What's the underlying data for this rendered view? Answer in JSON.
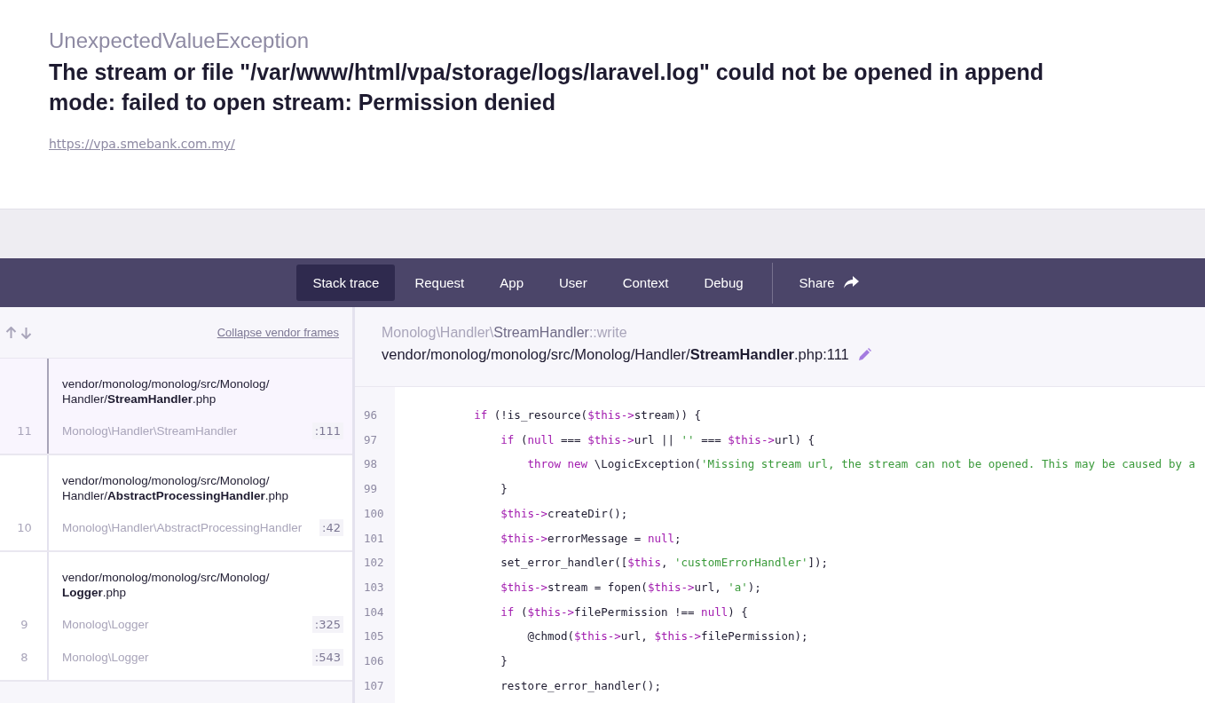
{
  "exception": {
    "class": "UnexpectedValueException",
    "message": "The stream or file \"/var/www/html/vpa/storage/logs/laravel.log\" could not be opened in append mode: failed to open stream: Permission denied",
    "url": "https://vpa.smebank.com.my/"
  },
  "tabs": [
    {
      "label": "Stack trace",
      "selected": true
    },
    {
      "label": "Request",
      "selected": false
    },
    {
      "label": "App",
      "selected": false
    },
    {
      "label": "User",
      "selected": false
    },
    {
      "label": "Context",
      "selected": false
    },
    {
      "label": "Debug",
      "selected": false
    }
  ],
  "share": {
    "label": "Share"
  },
  "sidebar": {
    "collapse_link": "Collapse vendor frames",
    "groups": [
      {
        "file": "vendor/monolog/monolog/src/Monolog/ Handler/**StreamHandler**.php",
        "selected": true,
        "calls": [
          {
            "number": "11",
            "class": "Monolog\\Handler\\StreamHandler",
            "line": ":111"
          }
        ]
      },
      {
        "file": "vendor/monolog/monolog/src/Monolog/ Handler/**AbstractProcessingHandler**.php",
        "selected": false,
        "calls": [
          {
            "number": "10",
            "class": "Monolog\\Handler\\AbstractProcessingHandler",
            "line": ":42"
          }
        ]
      },
      {
        "file": "vendor/monolog/monolog/src/Monolog/ **Logger**.php",
        "selected": false,
        "calls": [
          {
            "number": "9",
            "class": "Monolog\\Logger",
            "line": ":325"
          },
          {
            "number": "8",
            "class": "Monolog\\Logger",
            "line": ":543"
          }
        ]
      }
    ]
  },
  "frame": {
    "method": "Monolog\\Handler\\**StreamHandler**::write",
    "file": "vendor/monolog/monolog/src/Monolog/Handler/**StreamHandler**.php:111",
    "lines": [
      {
        "number": "96",
        "tokens": [
          {
            "kind": "kw",
            "text": "        if"
          },
          {
            "kind": "plain",
            "text": " (!is_resource("
          },
          {
            "kind": "var",
            "text": "$this->"
          },
          {
            "kind": "plain",
            "text": "stream)) {"
          }
        ]
      },
      {
        "number": "97",
        "tokens": [
          {
            "kind": "kw",
            "text": "            if"
          },
          {
            "kind": "plain",
            "text": " ("
          },
          {
            "kind": "kw",
            "text": "null"
          },
          {
            "kind": "plain",
            "text": " === "
          },
          {
            "kind": "var",
            "text": "$this->"
          },
          {
            "kind": "plain",
            "text": "url || "
          },
          {
            "kind": "str",
            "text": "''"
          },
          {
            "kind": "plain",
            "text": " === "
          },
          {
            "kind": "var",
            "text": "$this->"
          },
          {
            "kind": "plain",
            "text": "url) {"
          }
        ]
      },
      {
        "number": "98",
        "tokens": [
          {
            "kind": "kw",
            "text": "                throw new"
          },
          {
            "kind": "plain",
            "text": " \\LogicException("
          },
          {
            "kind": "str",
            "text": "'Missing stream url, the stream can not be opened. This may be caused by a"
          }
        ]
      },
      {
        "number": "99",
        "tokens": [
          {
            "kind": "plain",
            "text": "            }"
          }
        ]
      },
      {
        "number": "100",
        "tokens": [
          {
            "kind": "var",
            "text": "            $this->"
          },
          {
            "kind": "plain",
            "text": "createDir();"
          }
        ]
      },
      {
        "number": "101",
        "tokens": [
          {
            "kind": "var",
            "text": "            $this->"
          },
          {
            "kind": "plain",
            "text": "errorMessage = "
          },
          {
            "kind": "kw",
            "text": "null"
          },
          {
            "kind": "plain",
            "text": ";"
          }
        ]
      },
      {
        "number": "102",
        "tokens": [
          {
            "kind": "plain",
            "text": "            set_error_handler(["
          },
          {
            "kind": "var",
            "text": "$this"
          },
          {
            "kind": "plain",
            "text": ", "
          },
          {
            "kind": "str",
            "text": "'customErrorHandler'"
          },
          {
            "kind": "plain",
            "text": "]);"
          }
        ]
      },
      {
        "number": "103",
        "tokens": [
          {
            "kind": "var",
            "text": "            $this->"
          },
          {
            "kind": "plain",
            "text": "stream = fopen("
          },
          {
            "kind": "var",
            "text": "$this->"
          },
          {
            "kind": "plain",
            "text": "url, "
          },
          {
            "kind": "str",
            "text": "'a'"
          },
          {
            "kind": "plain",
            "text": ");"
          }
        ]
      },
      {
        "number": "104",
        "tokens": [
          {
            "kind": "kw",
            "text": "            if"
          },
          {
            "kind": "plain",
            "text": " ("
          },
          {
            "kind": "var",
            "text": "$this->"
          },
          {
            "kind": "plain",
            "text": "filePermission !== "
          },
          {
            "kind": "kw",
            "text": "null"
          },
          {
            "kind": "plain",
            "text": ") {"
          }
        ]
      },
      {
        "number": "105",
        "tokens": [
          {
            "kind": "plain",
            "text": "                @chmod("
          },
          {
            "kind": "var",
            "text": "$this->"
          },
          {
            "kind": "plain",
            "text": "url, "
          },
          {
            "kind": "var",
            "text": "$this->"
          },
          {
            "kind": "plain",
            "text": "filePermission);"
          }
        ]
      },
      {
        "number": "106",
        "tokens": [
          {
            "kind": "plain",
            "text": "            }"
          }
        ]
      },
      {
        "number": "107",
        "tokens": [
          {
            "kind": "plain",
            "text": "            restore_error_handler();"
          }
        ]
      }
    ]
  }
}
